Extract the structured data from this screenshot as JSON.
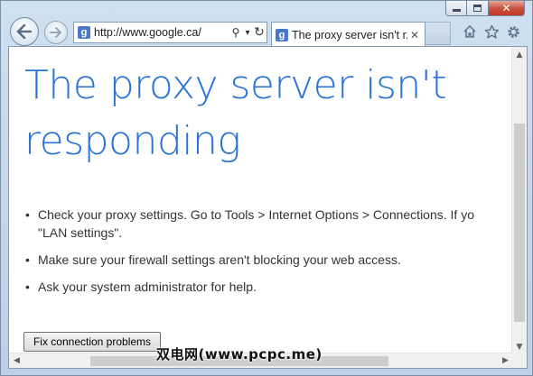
{
  "window": {
    "controls": {
      "minimize_icon": "minimize-icon",
      "maximize_icon": "maximize-icon",
      "close_glyph": "✕"
    }
  },
  "nav": {
    "back_icon": "back-arrow-icon",
    "forward_icon": "forward-arrow-icon"
  },
  "address_bar": {
    "favicon": "g",
    "url": "http://www.google.ca/",
    "search_glyph": "⚲",
    "dropdown_glyph": "▾",
    "refresh_glyph": "↻"
  },
  "tab": {
    "favicon": "g",
    "title": "The proxy server isn't r...",
    "close_glyph": "✕"
  },
  "toolbar": {
    "icons": [
      "home-icon",
      "favorites-star-icon",
      "settings-gear-icon"
    ]
  },
  "page": {
    "heading": "The proxy server isn't responding",
    "bullets": [
      {
        "line1": "Check your proxy settings. Go to Tools > Internet Options > Connections. If yo",
        "line2": "\"LAN settings\"."
      },
      {
        "line1": "Make sure your firewall settings aren't blocking your web access."
      },
      {
        "line1": "Ask your system administrator for help."
      }
    ],
    "fix_button": "Fix connection problems"
  },
  "scrollbars": {
    "up": "▲",
    "down": "▼",
    "left": "◀",
    "right": "▶"
  },
  "watermark": "双电网(www.pcpc.me)",
  "colors": {
    "heading": "#2a73d6",
    "chrome": "#c5d7ea",
    "close_button": "#c84d3b"
  }
}
